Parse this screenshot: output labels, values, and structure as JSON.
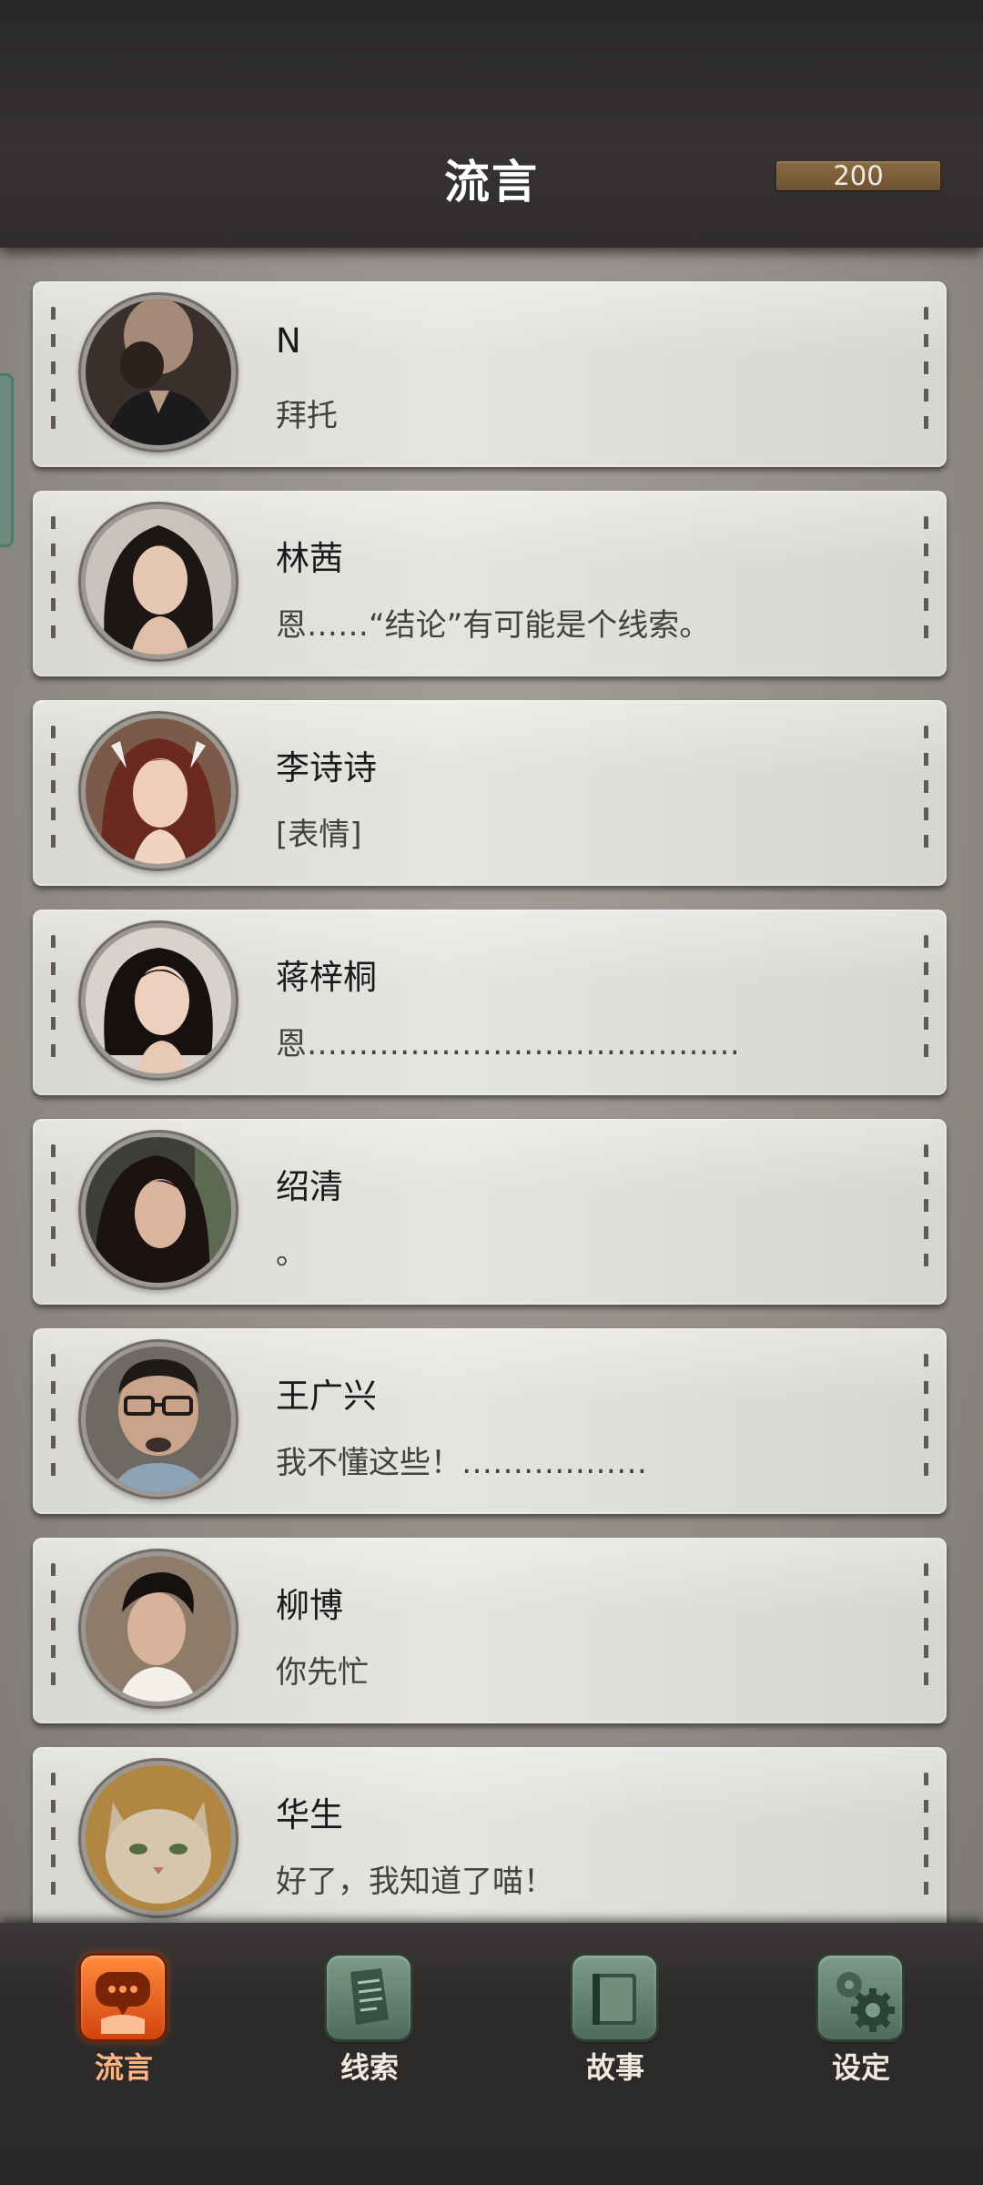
{
  "header": {
    "title": "流言",
    "coins": "200"
  },
  "chats": [
    {
      "name": "N",
      "message": "拜托"
    },
    {
      "name": "林茜",
      "message": "恩……“结论”有可能是个线索。"
    },
    {
      "name": "李诗诗",
      "message": "[表情]"
    },
    {
      "name": "蒋梓桐",
      "message": "恩……………………………………"
    },
    {
      "name": "绍清",
      "message": "。"
    },
    {
      "name": "王广兴",
      "message": "我不懂这些！………………"
    },
    {
      "name": "柳博",
      "message": "你先忙"
    },
    {
      "name": "华生",
      "message": "好了，我知道了喵！"
    }
  ],
  "nav": {
    "items": [
      {
        "label": "流言",
        "icon": "chat-bubble-icon",
        "active": true
      },
      {
        "label": "线索",
        "icon": "document-icon",
        "active": false
      },
      {
        "label": "故事",
        "icon": "book-icon",
        "active": false
      },
      {
        "label": "设定",
        "icon": "gear-icon",
        "active": false
      }
    ]
  },
  "colors": {
    "accent_active": "#e8601c",
    "nav_icon": "#5f7e6c",
    "header_bg": "#302d2c",
    "card_bg": "#e0deda"
  }
}
